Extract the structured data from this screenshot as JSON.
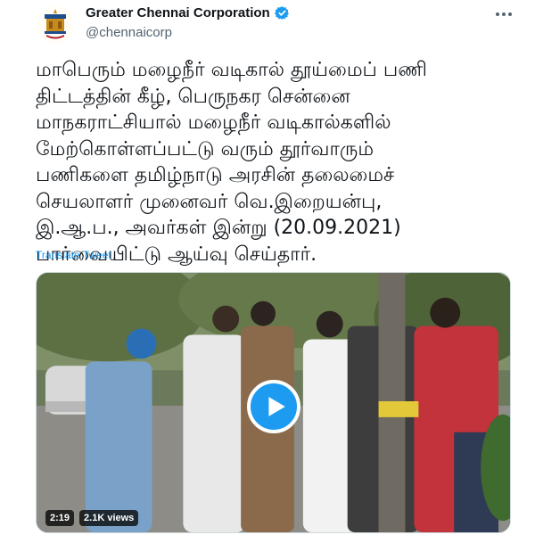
{
  "account": {
    "name": "Greater Chennai Corporation",
    "handle": "@chennaicorp",
    "verified": true
  },
  "menu": {
    "icon": "more-horizontal-icon"
  },
  "tweet": {
    "lines": [
      "மாபெரும் மழைநீர் வடிகால் தூய்மைப் பணி",
      "திட்டத்தின் கீழ், பெருநகர சென்னை",
      "மாநகராட்சியால் மழைநீர் வடிகால்களில்",
      "மேற்கொள்ளப்பட்டு வரும் தூர்வாரும்",
      "பணிகளை தமிழ்நாடு அரசின் தலைமைச்",
      "செயலாளர் முனைவர் வெ.இறையன்பு,",
      "இ.ஆ.ப., அவர்கள் இன்று (20.09.2021)",
      "பார்வையிட்டு ஆய்வு செய்தார்."
    ],
    "translate_label": "Translate Tweet"
  },
  "video": {
    "duration": "2:19",
    "views": "2.1K views",
    "play_icon": "play-icon"
  },
  "colors": {
    "accent": "#1d9bf0",
    "text": "#0f1419",
    "muted": "#536471"
  }
}
